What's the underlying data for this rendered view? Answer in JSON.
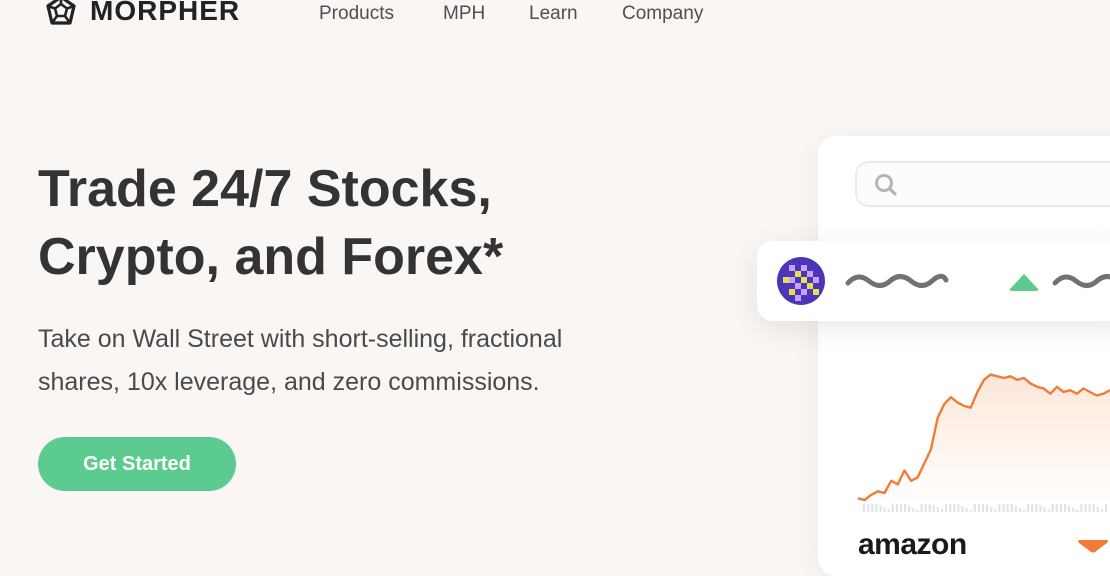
{
  "nav": {
    "brand": "MORPHER",
    "links": [
      "Products",
      "MPH",
      "Learn",
      "Company"
    ]
  },
  "hero": {
    "title_line1": "Trade 24/7 Stocks,",
    "title_line2": "Crypto, and Forex*",
    "subtitle_line1": "Take on Wall Street with short-selling, fractional",
    "subtitle_line2": "shares, 10x leverage, and zero commissions.",
    "cta_label": "Get Started"
  },
  "preview": {
    "search_icon": "search-icon",
    "ticker_icon": "checkered-token-icon",
    "ticker_trend": "up",
    "chart": {
      "type": "area",
      "series": [
        {
          "values": [
            2,
            1,
            4,
            6,
            5,
            12,
            10,
            18,
            12,
            14,
            22,
            30,
            48,
            56,
            60,
            57,
            55,
            54,
            63,
            70,
            73,
            72,
            71,
            72,
            70,
            71,
            68,
            66,
            65,
            62,
            66,
            63,
            64,
            62,
            65,
            63,
            61,
            62,
            64
          ]
        }
      ],
      "colors": {
        "line": "#f07c38",
        "fill_top": "#fde7d8",
        "fill_bottom": "#ffffff",
        "volume": "#e3e3e3"
      }
    },
    "company_label": "amazon",
    "company_trend": "down",
    "colors": {
      "up": "#5ccb8f",
      "down": "#f07c38"
    }
  },
  "colors": {
    "background": "#faf6f4",
    "accent": "#5ccb8f",
    "text": "#333333"
  }
}
